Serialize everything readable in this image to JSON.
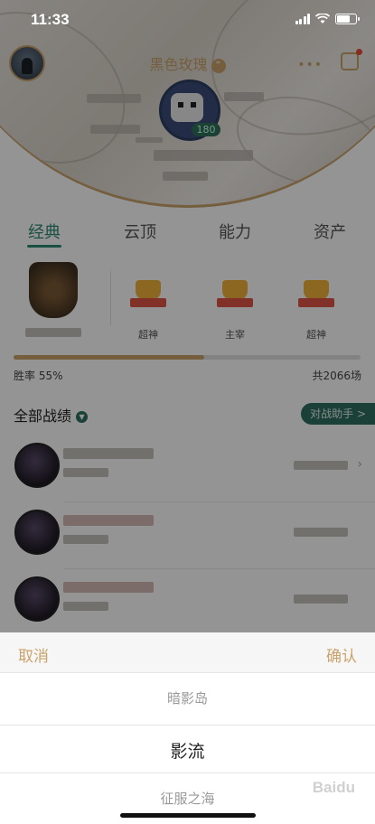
{
  "status_bar": {
    "time": "11:33"
  },
  "header": {
    "nickname": "黑色玫瑰",
    "level": "180"
  },
  "tabs": [
    {
      "label": "经典",
      "active": true
    },
    {
      "label": "云顶",
      "active": false
    },
    {
      "label": "能力",
      "active": false
    },
    {
      "label": "资产",
      "active": false
    }
  ],
  "ranks": [
    {
      "label": ""
    },
    {
      "label": "超神"
    },
    {
      "label": "主宰"
    },
    {
      "label": "超神"
    }
  ],
  "stats": {
    "win_rate": "胜率 55%",
    "win_rate_value": 0.55,
    "total": "共2066场"
  },
  "records": {
    "title": "全部战绩",
    "helper": "对战助手 >"
  },
  "picker": {
    "cancel": "取消",
    "confirm": "确认",
    "options": [
      "暗影岛",
      "影流",
      "征服之海"
    ],
    "selected": "影流"
  },
  "watermark": "Baidu",
  "colors": {
    "accent": "#c9a36a",
    "green": "#2e8a72",
    "helper": "#2e6e60"
  }
}
